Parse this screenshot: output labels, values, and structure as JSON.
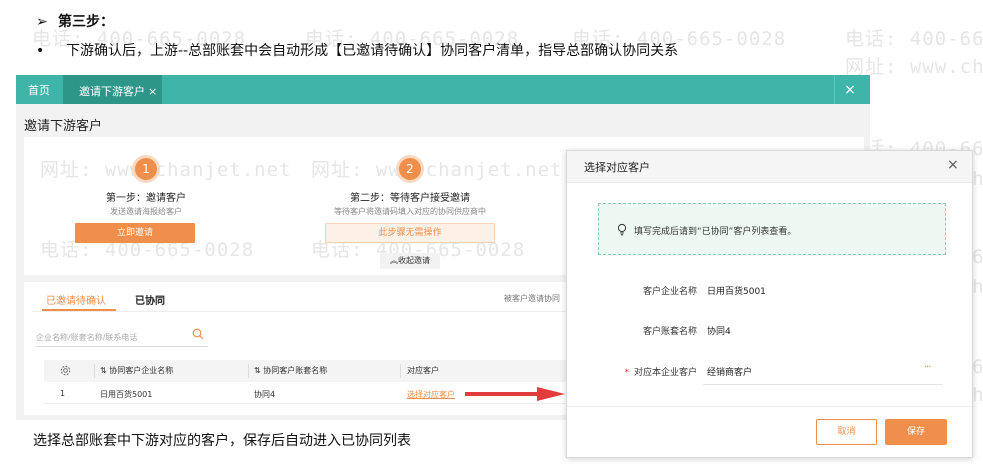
{
  "slide": {
    "step_arrow": "➢",
    "step_title": "第三步：",
    "bullet": "•",
    "description": "下游确认后，上游--总部账套中会自动形成【已邀请待确认】协同客户清单，指导总部确认协同关系",
    "caption": "选择总部账套中下游对应的客户，保存后自动进入已协同列表"
  },
  "watermark": {
    "phone": "电话: 400-665-0028",
    "site": "网址: www.chanjet.net",
    "phone_partial": "电话: 400-665",
    "site_partial": "网址: www.chan"
  },
  "topbar": {
    "home": "首页",
    "active_tab": "邀请下游客户",
    "tab_close": "×",
    "window_close": "×"
  },
  "page_title": "邀请下游客户",
  "steps": [
    {
      "num": "1",
      "title": "第一步：邀请客户",
      "desc": "发送邀请海报给客户",
      "button": "立即邀请"
    },
    {
      "num": "2",
      "title": "第二步：等待客户接受邀请",
      "desc": "等待客户将邀请码填入对应的协同供应商中",
      "button": "此步骤无需操作"
    }
  ],
  "collapse_label": "︽收起邀请",
  "list": {
    "tabs": [
      "已邀请待确认",
      "已协同"
    ],
    "right_note": "被客户邀请协同",
    "search_placeholder": "企业名称/账套名称/联系电话",
    "columns": [
      "协同客户企业名称",
      "协同客户账套名称",
      "对应客户"
    ],
    "rows": [
      {
        "index": "1",
        "company": "日用百货5001",
        "account": "协同4",
        "action": "选择对应客户"
      }
    ]
  },
  "modal": {
    "title": "选择对应客户",
    "close": "×",
    "tip": "填写完成后请到“已协同”客户列表查看。",
    "fields": [
      {
        "label": "客户企业名称",
        "value": "日用百货5001"
      },
      {
        "label": "客户账套名称",
        "value": "协同4"
      }
    ],
    "required_mark": "*",
    "required_label": "对应本企业客户",
    "required_value": "经销商客户",
    "more": "···",
    "cancel": "取消",
    "save": "保存"
  },
  "colors": {
    "teal": "#3eb5a8",
    "orange": "#f08f4b",
    "red_arrow": "#e23c3c"
  }
}
